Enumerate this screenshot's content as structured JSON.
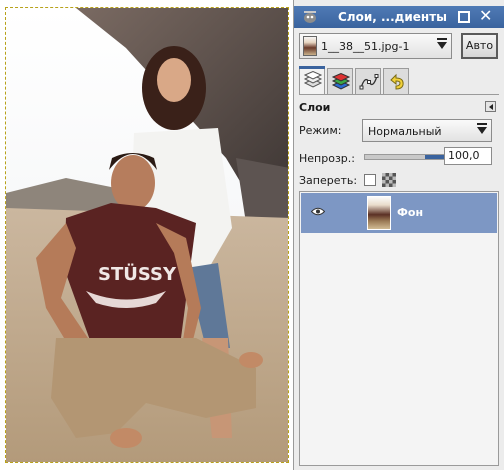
{
  "canvas": {
    "image": "photo-couple-on-sand"
  },
  "dock": {
    "title": "Слои, ...диенты",
    "image_selector": {
      "label": "1__38__51.jpg-1"
    },
    "auto_button": "Авто",
    "tabs": [
      {
        "name": "layers",
        "icon": "layers-tab-icon",
        "active": true
      },
      {
        "name": "channels",
        "icon": "channels-tab-icon",
        "active": false
      },
      {
        "name": "paths",
        "icon": "paths-tab-icon",
        "active": false
      },
      {
        "name": "undo-history",
        "icon": "undo-tab-icon",
        "active": false
      }
    ],
    "layers_panel": {
      "title": "Слои",
      "mode_label": "Режим:",
      "mode_value": "Нормальный",
      "opacity_label": "Непрозр.:",
      "opacity_value": "100,0",
      "opacity_fraction": 1.0,
      "lock_label": "Запереть:",
      "layers": [
        {
          "name": "Фон",
          "visible": true,
          "selected": true
        }
      ]
    }
  },
  "colors": {
    "titlebar": "#3a639e",
    "selection": "#7d97c4",
    "marching_ants": "#b8a21a"
  }
}
